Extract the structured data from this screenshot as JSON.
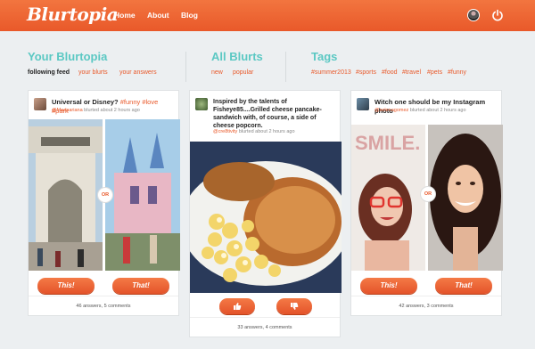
{
  "header": {
    "logo": "Blurtopia",
    "nav": [
      "Home",
      "About",
      "Blog"
    ],
    "avatar_icon": "user-avatar",
    "power_icon": "power-icon",
    "accent": "#e9592a"
  },
  "sections": {
    "your": {
      "title": "Your Blurtopia",
      "links": [
        "following feed",
        "your blurts",
        "your answers"
      ]
    },
    "all": {
      "title": "All Blurts",
      "links": [
        "new",
        "popular"
      ]
    },
    "tags": {
      "title": "Tags",
      "links": [
        "#summer2013",
        "#sports",
        "#food",
        "#travel",
        "#pets",
        "#funny"
      ]
    }
  },
  "cards": [
    {
      "title": "Universal or Disney?",
      "tags": "#funny #love #park",
      "user": "@Maaaariana",
      "meta": "blurted about 2 hours ago",
      "or_label": "OR",
      "buttons": [
        "This!",
        "That!"
      ],
      "footer": "46 answers, 5 comments"
    },
    {
      "title": "Inspired by the talents of Fisheye85....Grilled cheese pancake-sandwich with, of course, a side of cheese popcorn.",
      "user": "@cre8tivity",
      "meta": "blurted about 2 hours ago",
      "buttons": [
        "thumbs-up-icon",
        "thumbs-down-icon"
      ],
      "footer": "33 answers, 4 comments"
    },
    {
      "title": "Witch one should be my Instagram photo",
      "user": "@selenagomez",
      "meta": "blurted about 2 hours ago",
      "or_label": "OR",
      "sign_text": "SMILE.",
      "buttons": [
        "This!",
        "That!"
      ],
      "footer": "42 answers, 3 comments"
    }
  ]
}
